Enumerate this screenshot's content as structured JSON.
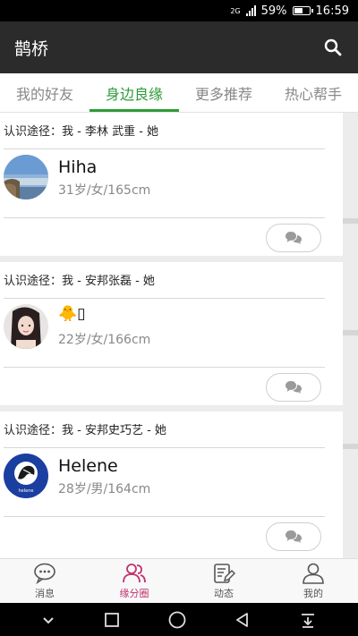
{
  "status_bar": {
    "network": "2G",
    "battery": "59%",
    "battery_level": 0.59,
    "time": "16:59"
  },
  "app_bar": {
    "title": "鹊桥",
    "search_icon": "search-icon"
  },
  "tabs": [
    {
      "label": "我的好友",
      "active": false
    },
    {
      "label": "身边良缘",
      "active": true
    },
    {
      "label": "更多推荐",
      "active": false
    },
    {
      "label": "热心帮手",
      "active": false
    }
  ],
  "cards": [
    {
      "path": "认识途径：我 - 李林 武重 - 她",
      "name": "Hiha",
      "meta": "31岁/女/165cm",
      "avatar": "landscape-avatar"
    },
    {
      "path": "认识途径：我 - 安邦张磊 - 她",
      "name": "🐥▯",
      "meta": "22岁/女/166cm",
      "avatar": "girl-photo-avatar"
    },
    {
      "path": "认识途径：我 - 安邦史巧艺 - 她",
      "name": "Helene",
      "meta": "28岁/男/164cm",
      "avatar": "helene-logo-avatar",
      "avatar_text": "helene"
    }
  ],
  "bottom_nav": [
    {
      "label": "消息",
      "icon": "chat-bubble-icon",
      "active": false
    },
    {
      "label": "缘分圈",
      "icon": "people-icon",
      "active": true
    },
    {
      "label": "动态",
      "icon": "edit-note-icon",
      "active": false
    },
    {
      "label": "我的",
      "icon": "person-icon",
      "active": false
    }
  ],
  "colors": {
    "accent_green": "#2f9b38",
    "accent_pink": "#c0326e",
    "app_bar": "#2b2b2b"
  }
}
